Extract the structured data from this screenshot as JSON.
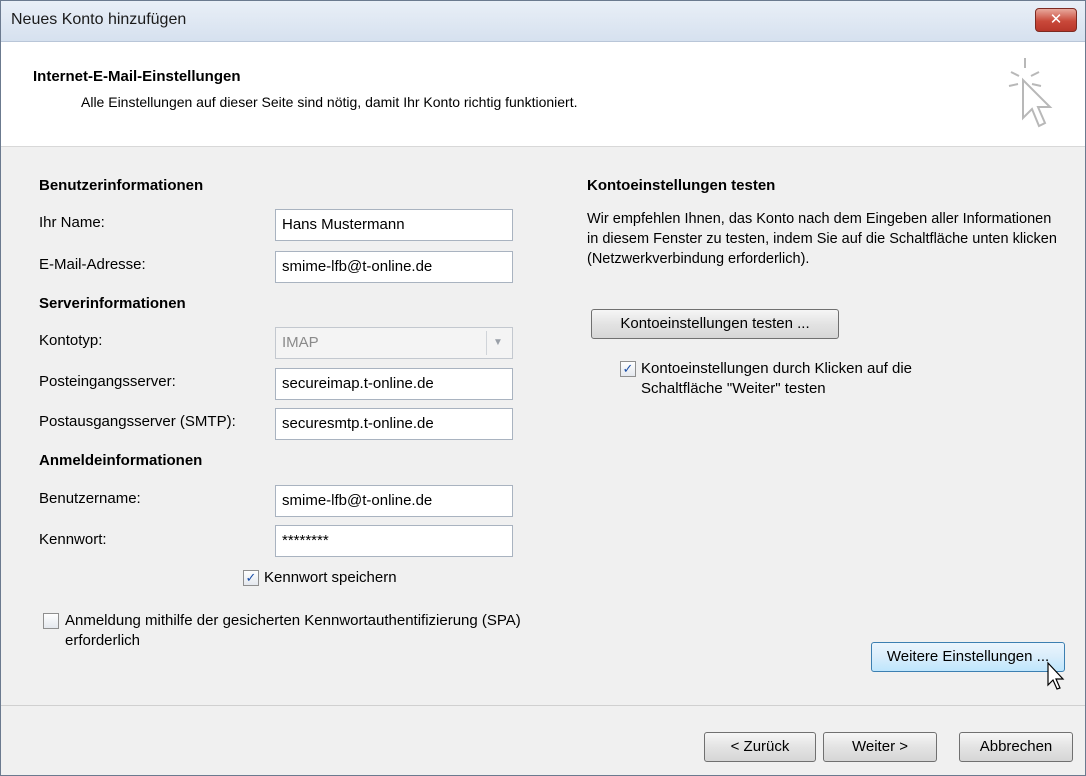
{
  "window": {
    "title": "Neues Konto hinzufügen",
    "close_glyph": "✕"
  },
  "header": {
    "title": "Internet-E-Mail-Einstellungen",
    "subtitle": "Alle Einstellungen auf dieser Seite sind nötig, damit Ihr Konto richtig funktioniert.",
    "icon": "wizard-cursor-icon"
  },
  "user": {
    "section": "Benutzerinformationen",
    "name_label": "Ihr Name:",
    "name_value": "Hans Mustermann",
    "email_label": "E-Mail-Adresse:",
    "email_value": "smime-lfb@t-online.de"
  },
  "server": {
    "section": "Serverinformationen",
    "type_label": "Kontotyp:",
    "type_value": "IMAP",
    "incoming_label": "Posteingangsserver:",
    "incoming_value": "secureimap.t-online.de",
    "outgoing_label": "Postausgangsserver (SMTP):",
    "outgoing_value": "securesmtp.t-online.de"
  },
  "login": {
    "section": "Anmeldeinformationen",
    "user_label": "Benutzername:",
    "user_value": "smime-lfb@t-online.de",
    "pw_label": "Kennwort:",
    "pw_value": "********",
    "save_pw_label": "Kennwort speichern",
    "save_pw_checked": true,
    "spa_label": "Anmeldung mithilfe der gesicherten Kennwortauthentifizierung (SPA) erforderlich",
    "spa_checked": false
  },
  "test": {
    "section": "Kontoeinstellungen testen",
    "description": "Wir empfehlen Ihnen, das Konto nach dem Eingeben aller Informationen in diesem Fenster zu testen, indem Sie auf die Schaltfläche unten klicken (Netzwerkverbindung erforderlich).",
    "button": "Kontoeinstellungen testen ...",
    "auto_test_label": "Kontoeinstellungen durch Klicken auf die Schaltfläche \"Weiter\" testen",
    "auto_test_checked": true
  },
  "buttons": {
    "more_settings": "Weitere Einstellungen ...",
    "back": "< Zurück",
    "next": "Weiter >",
    "cancel": "Abbrechen"
  },
  "check_glyph": "✓"
}
